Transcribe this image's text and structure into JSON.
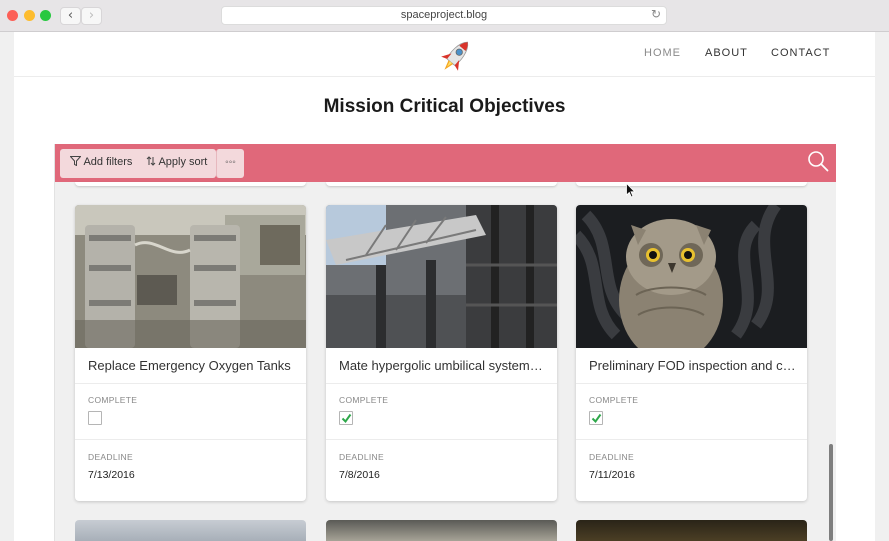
{
  "browser": {
    "url": "spaceproject.blog"
  },
  "site": {
    "logo": "rocket-icon",
    "nav": [
      {
        "label": "HOME"
      },
      {
        "label": "ABOUT"
      },
      {
        "label": "CONTACT"
      }
    ],
    "title": "Mission Critical Objectives"
  },
  "toolbar": {
    "add_filters": "Add filters",
    "apply_sort": "Apply sort",
    "more": "◦◦◦",
    "accent": "#e0687a"
  },
  "cards": [
    {
      "title": "Replace Emergency Oxygen Tanks",
      "complete_label": "COMPLETE",
      "complete": false,
      "deadline_label": "DEADLINE",
      "deadline": "7/13/2016",
      "image": "oxygen-tanks-photo"
    },
    {
      "title": "Mate hypergolic umbilical system…",
      "complete_label": "COMPLETE",
      "complete": true,
      "deadline_label": "DEADLINE",
      "deadline": "7/8/2016",
      "image": "launch-tower-photo"
    },
    {
      "title": "Preliminary FOD inspection and c…",
      "complete_label": "COMPLETE",
      "complete": true,
      "deadline_label": "DEADLINE",
      "deadline": "7/11/2016",
      "image": "owl-photo"
    }
  ]
}
